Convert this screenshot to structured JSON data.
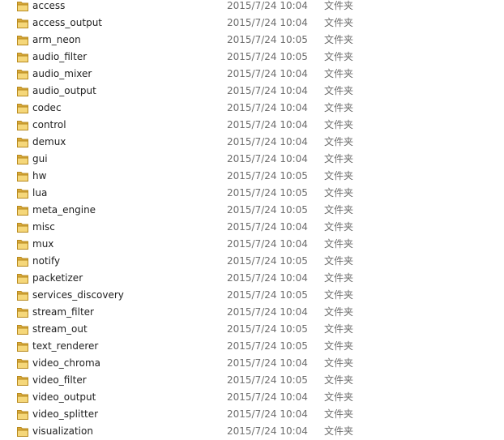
{
  "files": [
    {
      "name": "access",
      "date": "2015/7/24 10:04",
      "type": "文件夹",
      "icon": "folder-icon"
    },
    {
      "name": "access_output",
      "date": "2015/7/24 10:04",
      "type": "文件夹",
      "icon": "folder-icon"
    },
    {
      "name": "arm_neon",
      "date": "2015/7/24 10:05",
      "type": "文件夹",
      "icon": "folder-icon"
    },
    {
      "name": "audio_filter",
      "date": "2015/7/24 10:05",
      "type": "文件夹",
      "icon": "folder-icon"
    },
    {
      "name": "audio_mixer",
      "date": "2015/7/24 10:04",
      "type": "文件夹",
      "icon": "folder-icon"
    },
    {
      "name": "audio_output",
      "date": "2015/7/24 10:04",
      "type": "文件夹",
      "icon": "folder-icon"
    },
    {
      "name": "codec",
      "date": "2015/7/24 10:04",
      "type": "文件夹",
      "icon": "folder-icon"
    },
    {
      "name": "control",
      "date": "2015/7/24 10:04",
      "type": "文件夹",
      "icon": "folder-icon"
    },
    {
      "name": "demux",
      "date": "2015/7/24 10:04",
      "type": "文件夹",
      "icon": "folder-icon"
    },
    {
      "name": "gui",
      "date": "2015/7/24 10:04",
      "type": "文件夹",
      "icon": "folder-icon"
    },
    {
      "name": "hw",
      "date": "2015/7/24 10:05",
      "type": "文件夹",
      "icon": "folder-icon"
    },
    {
      "name": "lua",
      "date": "2015/7/24 10:05",
      "type": "文件夹",
      "icon": "folder-icon"
    },
    {
      "name": "meta_engine",
      "date": "2015/7/24 10:05",
      "type": "文件夹",
      "icon": "folder-icon"
    },
    {
      "name": "misc",
      "date": "2015/7/24 10:04",
      "type": "文件夹",
      "icon": "folder-icon"
    },
    {
      "name": "mux",
      "date": "2015/7/24 10:04",
      "type": "文件夹",
      "icon": "folder-icon"
    },
    {
      "name": "notify",
      "date": "2015/7/24 10:05",
      "type": "文件夹",
      "icon": "folder-icon"
    },
    {
      "name": "packetizer",
      "date": "2015/7/24 10:04",
      "type": "文件夹",
      "icon": "folder-icon"
    },
    {
      "name": "services_discovery",
      "date": "2015/7/24 10:05",
      "type": "文件夹",
      "icon": "folder-icon"
    },
    {
      "name": "stream_filter",
      "date": "2015/7/24 10:04",
      "type": "文件夹",
      "icon": "folder-icon"
    },
    {
      "name": "stream_out",
      "date": "2015/7/24 10:05",
      "type": "文件夹",
      "icon": "folder-icon"
    },
    {
      "name": "text_renderer",
      "date": "2015/7/24 10:05",
      "type": "文件夹",
      "icon": "folder-icon"
    },
    {
      "name": "video_chroma",
      "date": "2015/7/24 10:04",
      "type": "文件夹",
      "icon": "folder-icon"
    },
    {
      "name": "video_filter",
      "date": "2015/7/24 10:05",
      "type": "文件夹",
      "icon": "folder-icon"
    },
    {
      "name": "video_output",
      "date": "2015/7/24 10:04",
      "type": "文件夹",
      "icon": "folder-icon"
    },
    {
      "name": "video_splitter",
      "date": "2015/7/24 10:04",
      "type": "文件夹",
      "icon": "folder-icon"
    },
    {
      "name": "visualization",
      "date": "2015/7/24 10:04",
      "type": "文件夹",
      "icon": "folder-icon"
    }
  ],
  "colors": {
    "name_text": "#1e1e1e",
    "meta_text": "#6d6d6d",
    "folder_back": "#d9a93a",
    "folder_front": "#f5d77a",
    "folder_edge": "#b88a1e"
  }
}
